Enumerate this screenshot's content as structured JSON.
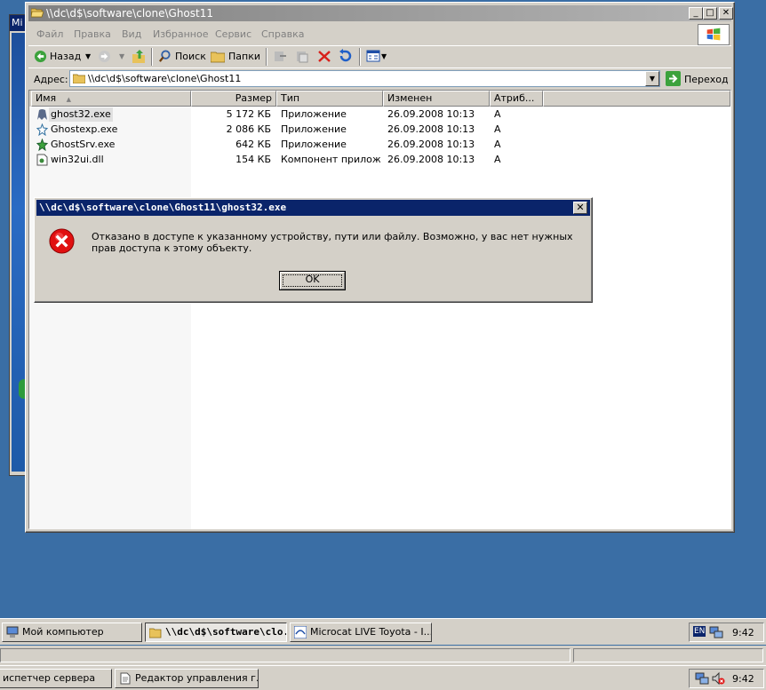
{
  "explorer": {
    "title": "\\\\dc\\d$\\software\\clone\\Ghost11",
    "menu": [
      "Файл",
      "Правка",
      "Вид",
      "Избранное",
      "Сервис",
      "Справка"
    ],
    "toolbar": {
      "back": "Назад",
      "search": "Поиск",
      "folders": "Папки"
    },
    "address": {
      "label": "Адрес:",
      "value": "\\\\dc\\d$\\software\\clone\\Ghost11",
      "go": "Переход"
    },
    "columns": [
      "Имя",
      "Размер",
      "Тип",
      "Изменен",
      "Атриб..."
    ],
    "files": [
      {
        "name": "ghost32.exe",
        "size": "5 172 КБ",
        "type": "Приложение",
        "modified": "26.09.2008 10:13",
        "attr": "A"
      },
      {
        "name": "Ghostexp.exe",
        "size": "2 086 КБ",
        "type": "Приложение",
        "modified": "26.09.2008 10:13",
        "attr": "A"
      },
      {
        "name": "GhostSrv.exe",
        "size": "642 КБ",
        "type": "Приложение",
        "modified": "26.09.2008 10:13",
        "attr": "A"
      },
      {
        "name": "win32ui.dll",
        "size": "154 КБ",
        "type": "Компонент прилож...",
        "modified": "26.09.2008 10:13",
        "attr": "A"
      }
    ]
  },
  "background_window": {
    "title": "Mi"
  },
  "dialog": {
    "title": "\\\\dc\\d$\\software\\clone\\Ghost11\\ghost32.exe",
    "message": "Отказано в доступе к указанному устройству, пути или файлу. Возможно,  у вас нет нужных прав доступа к этому объекту.",
    "ok": "OK"
  },
  "taskbar_top": {
    "buttons": [
      "Мой компьютер",
      "\\\\dc\\d$\\software\\clo...",
      "Microcat LIVE Toyota - I..."
    ],
    "lang": "EN",
    "time": "9:42"
  },
  "taskbar_bottom": {
    "buttons": [
      "испетчер сервера",
      "Редактор управления г..."
    ],
    "time": "9:42"
  },
  "colors": {
    "desktop": "#3a6ea5",
    "title_inactive": "#808080",
    "title_active": "#0a246a",
    "face": "#d4d0c8"
  }
}
